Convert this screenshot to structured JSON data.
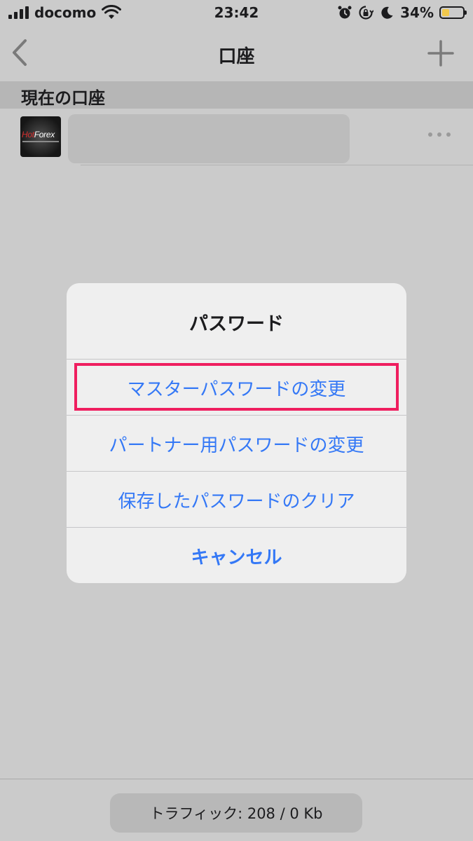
{
  "status_bar": {
    "carrier": "docomo",
    "time": "23:42",
    "battery_percent": "34%",
    "battery_level": 0.34,
    "icons": [
      "signal-icon",
      "wifi-icon",
      "alarm-icon",
      "orientation-lock-icon",
      "moon-icon",
      "battery-icon"
    ]
  },
  "nav": {
    "title": "口座",
    "back_icon": "chevron-left-icon",
    "add_icon": "plus-icon"
  },
  "section": {
    "header": "現在の口座"
  },
  "account": {
    "logo_text_hot": "Hot",
    "logo_text_forex": "Forex",
    "more_icon": "ellipsis-icon"
  },
  "dialog": {
    "title": "パスワード",
    "actions": [
      {
        "label": "マスターパスワードの変更"
      },
      {
        "label": "パートナー用パスワードの変更"
      },
      {
        "label": "保存したパスワードのクリア"
      },
      {
        "label": "キャンセル"
      }
    ]
  },
  "footer": {
    "traffic": "トラフィック: 208 / 0 Kb"
  },
  "colors": {
    "accent": "#3478f6",
    "highlight": "#ef1e5f",
    "backdrop": "#cbcbcb"
  }
}
